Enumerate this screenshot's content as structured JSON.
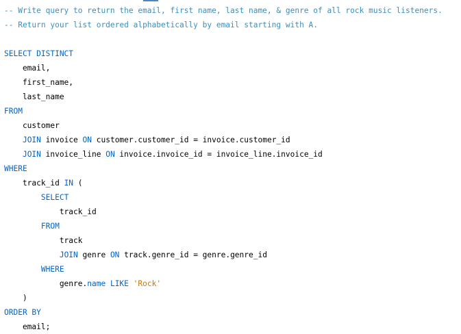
{
  "editor": {
    "lines": [
      {
        "tokens": [
          {
            "t": "comment",
            "v": "-- Write query to return the email, first name, last name, & genre of all rock music listeners."
          }
        ]
      },
      {
        "tokens": [
          {
            "t": "comment",
            "v": "-- Return your list ordered alphabetically by email starting with A."
          }
        ]
      },
      {
        "tokens": []
      },
      {
        "tokens": [
          {
            "t": "kw",
            "v": "SELECT DISTINCT"
          }
        ]
      },
      {
        "tokens": [
          {
            "t": "plain",
            "v": "    email,"
          }
        ]
      },
      {
        "tokens": [
          {
            "t": "plain",
            "v": "    first_name,"
          }
        ]
      },
      {
        "tokens": [
          {
            "t": "plain",
            "v": "    last_name"
          }
        ]
      },
      {
        "tokens": [
          {
            "t": "kw",
            "v": "FROM"
          }
        ]
      },
      {
        "tokens": [
          {
            "t": "plain",
            "v": "    customer"
          }
        ]
      },
      {
        "tokens": [
          {
            "t": "plain",
            "v": "    "
          },
          {
            "t": "kw",
            "v": "JOIN"
          },
          {
            "t": "plain",
            "v": " invoice "
          },
          {
            "t": "kw",
            "v": "ON"
          },
          {
            "t": "plain",
            "v": " customer.customer_id = invoice.customer_id"
          }
        ]
      },
      {
        "tokens": [
          {
            "t": "plain",
            "v": "    "
          },
          {
            "t": "kw",
            "v": "JOIN"
          },
          {
            "t": "plain",
            "v": " invoice_line "
          },
          {
            "t": "kw",
            "v": "ON"
          },
          {
            "t": "plain",
            "v": " invoice.invoice_id = invoice_line.invoice_id"
          }
        ]
      },
      {
        "tokens": [
          {
            "t": "kw",
            "v": "WHERE"
          }
        ]
      },
      {
        "tokens": [
          {
            "t": "plain",
            "v": "    track_id "
          },
          {
            "t": "kw",
            "v": "IN"
          },
          {
            "t": "plain",
            "v": " ("
          }
        ]
      },
      {
        "tokens": [
          {
            "t": "plain",
            "v": "        "
          },
          {
            "t": "kw",
            "v": "SELECT"
          }
        ]
      },
      {
        "tokens": [
          {
            "t": "plain",
            "v": "            track_id"
          }
        ]
      },
      {
        "tokens": [
          {
            "t": "plain",
            "v": "        "
          },
          {
            "t": "kw",
            "v": "FROM"
          }
        ]
      },
      {
        "tokens": [
          {
            "t": "plain",
            "v": "            track"
          }
        ]
      },
      {
        "tokens": [
          {
            "t": "plain",
            "v": "            "
          },
          {
            "t": "kw",
            "v": "JOIN"
          },
          {
            "t": "plain",
            "v": " genre "
          },
          {
            "t": "kw",
            "v": "ON"
          },
          {
            "t": "plain",
            "v": " track.genre_id = genre.genre_id"
          }
        ]
      },
      {
        "tokens": [
          {
            "t": "plain",
            "v": "        "
          },
          {
            "t": "kw",
            "v": "WHERE"
          }
        ]
      },
      {
        "tokens": [
          {
            "t": "plain",
            "v": "            genre."
          },
          {
            "t": "kw",
            "v": "name"
          },
          {
            "t": "plain",
            "v": " "
          },
          {
            "t": "kw",
            "v": "LIKE"
          },
          {
            "t": "plain",
            "v": " "
          },
          {
            "t": "str",
            "v": "'Rock'"
          }
        ]
      },
      {
        "tokens": [
          {
            "t": "plain",
            "v": "    )"
          }
        ]
      },
      {
        "tokens": [
          {
            "t": "kw",
            "v": "ORDER BY"
          }
        ]
      },
      {
        "tokens": [
          {
            "t": "plain",
            "v": "    email;"
          }
        ]
      }
    ]
  },
  "colors": {
    "comment": "#3a8fc0",
    "keyword": "#0064c8",
    "string": "#c5780a",
    "text": "#000000",
    "background": "#ffffff"
  }
}
